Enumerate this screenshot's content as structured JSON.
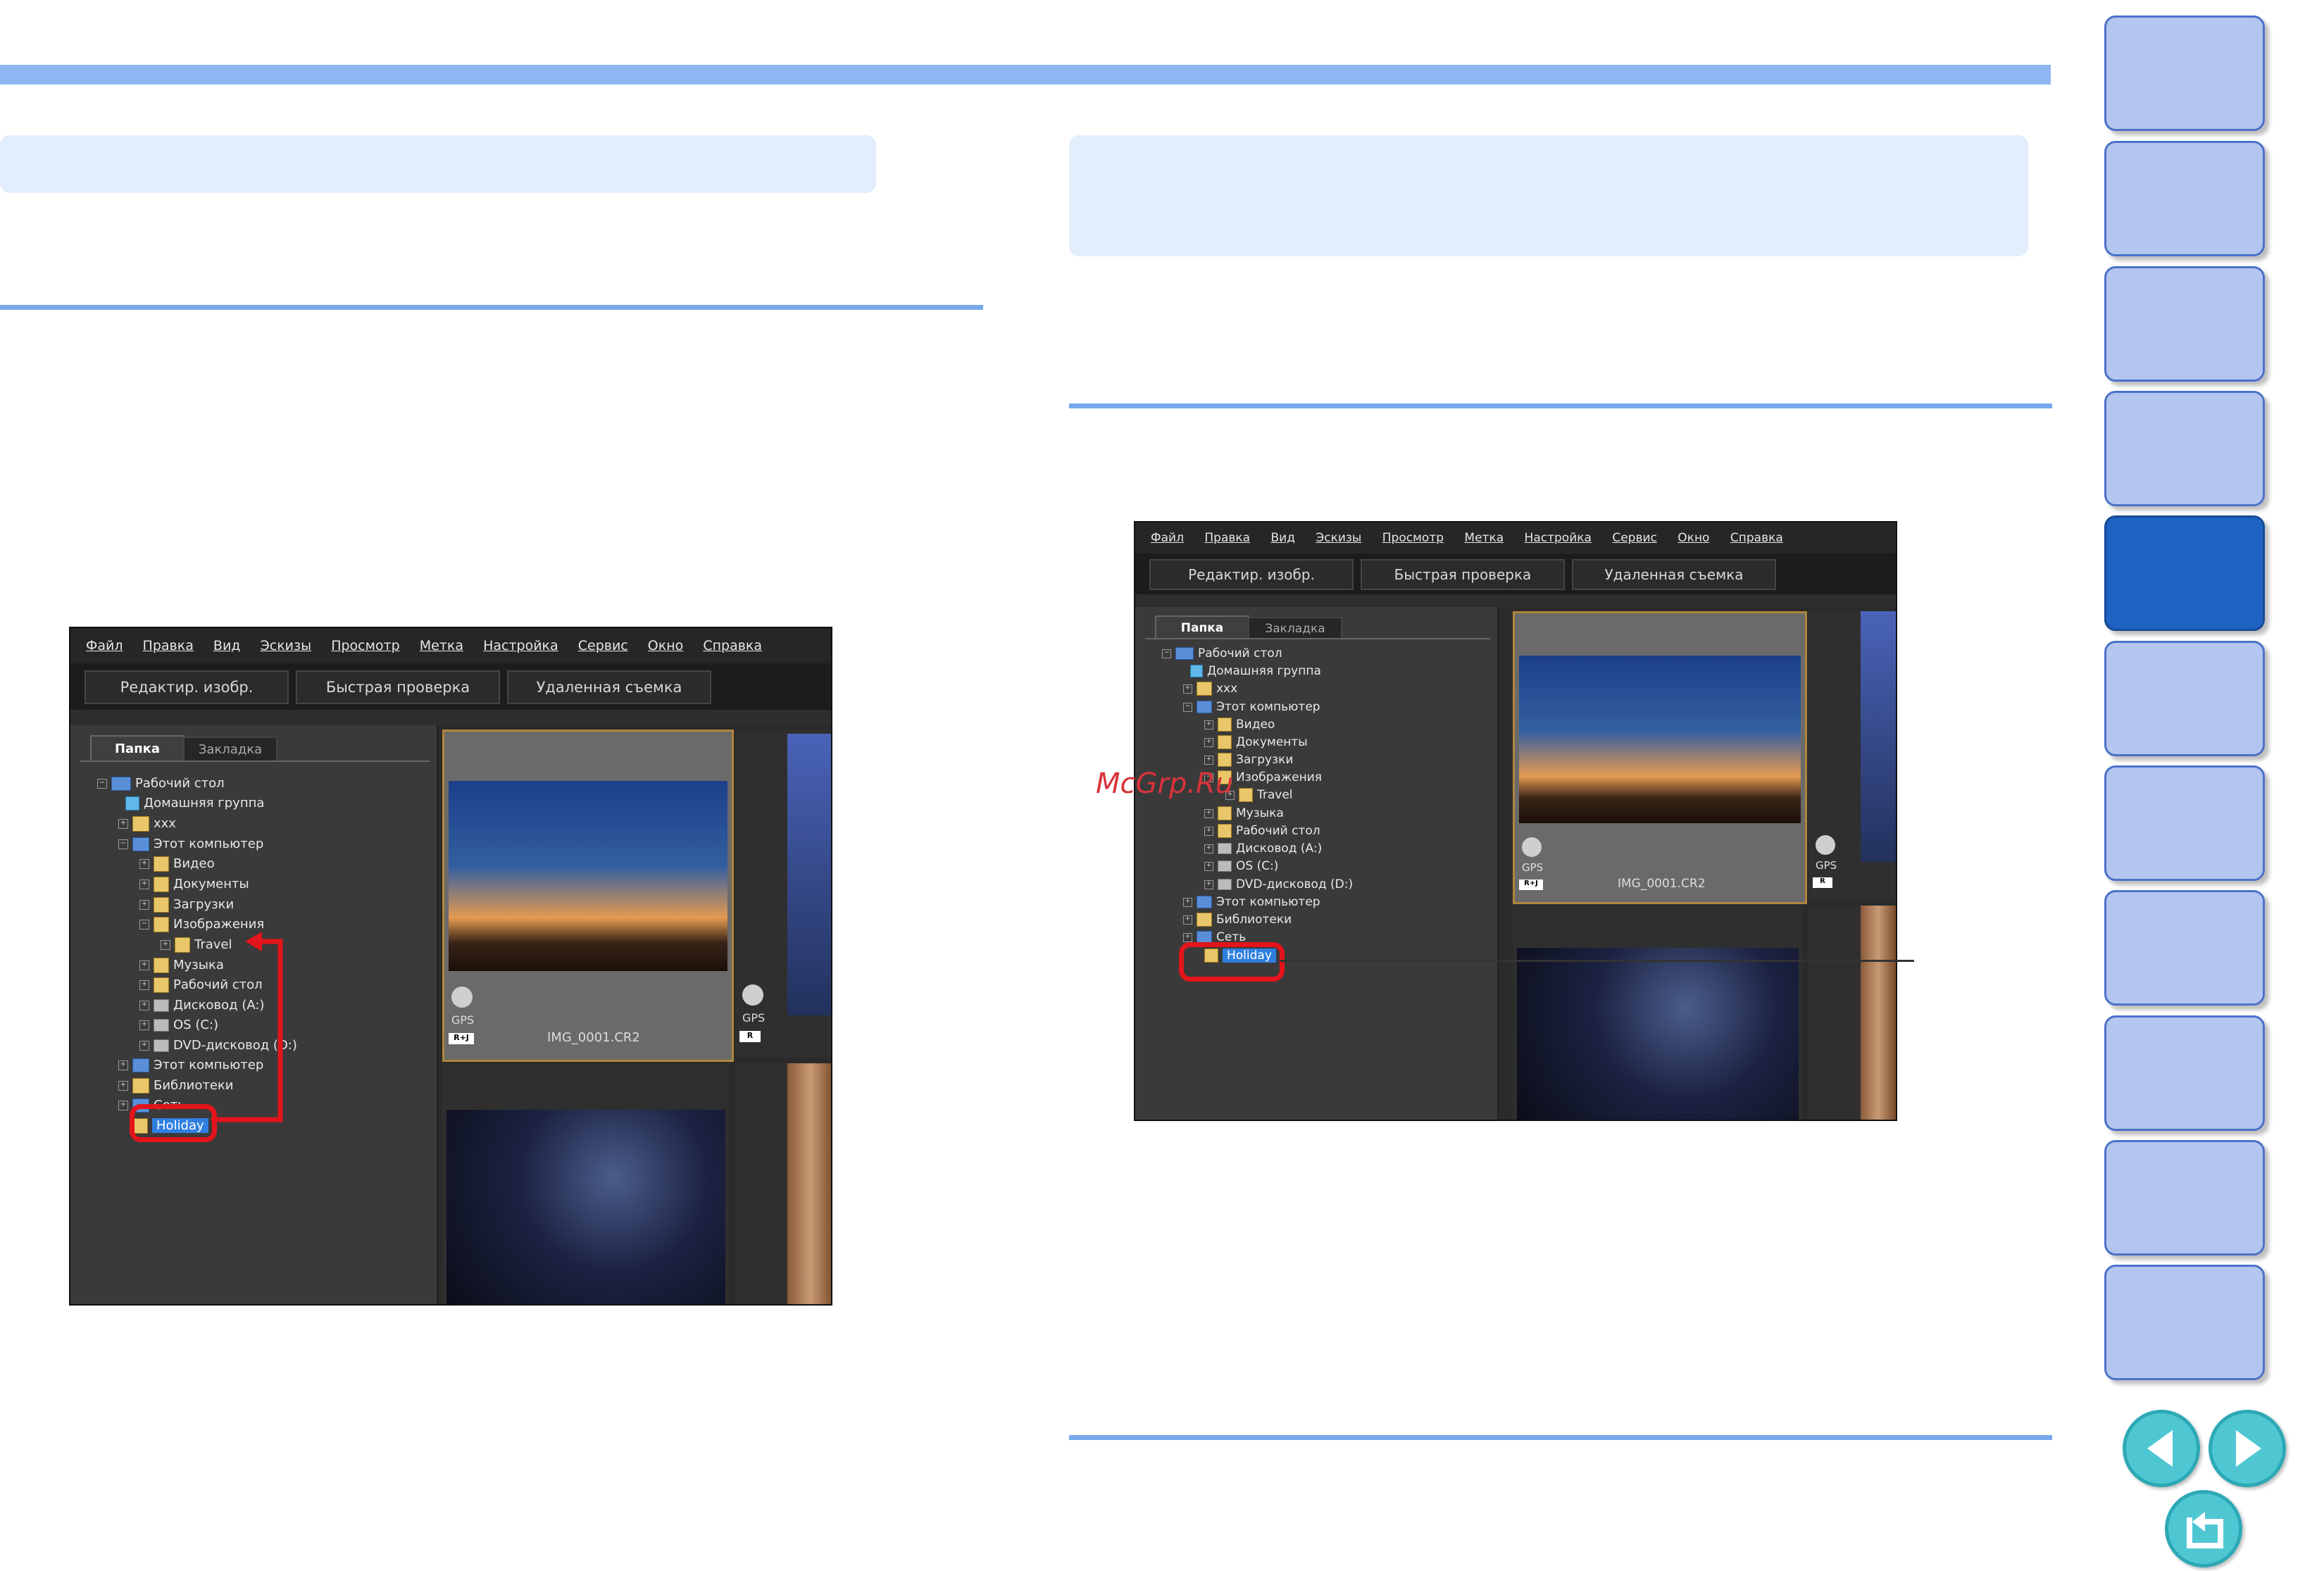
{
  "watermark": "McGrp.Ru",
  "menu": [
    "Файл",
    "Правка",
    "Вид",
    "Эскизы",
    "Просмотр",
    "Метка",
    "Настройка",
    "Сервис",
    "Окно",
    "Справка"
  ],
  "toolbar": [
    "Редактир. изобр.",
    "Быстрая проверка",
    "Удаленная съемка"
  ],
  "tabs": [
    "Папка",
    "Закладка"
  ],
  "tree_left": [
    "Рабочий стол",
    "Домашняя группа",
    "xxx",
    "Этот компьютер",
    "Видео",
    "Документы",
    "Загрузки",
    "Изображения",
    "Travel",
    "Музыка",
    "Рабочий стол",
    "Дисковод (A:)",
    "OS (C:)",
    "DVD-дисковод (D:)",
    "Этот компьютер",
    "Библиотеки",
    "Сеть",
    "Holiday"
  ],
  "tree_right": [
    "Рабочий стол",
    "Домашняя группа",
    "xxx",
    "Этот компьютер",
    "Видео",
    "Документы",
    "Загрузки",
    "Изображения",
    "Travel",
    "Музыка",
    "Рабочий стол",
    "Дисковод (A:)",
    "OS (C:)",
    "DVD-дисковод (D:)",
    "Этот компьютер",
    "Библиотеки",
    "Сеть",
    "Holiday"
  ],
  "thumb": {
    "gps": "GPS",
    "badge1": "R+J",
    "badge2": "R",
    "filename": "IMG_0001.CR2"
  },
  "colors": {
    "accent": "#78a8ec",
    "highlight": "#e3141b",
    "selection": "#2f7fe0"
  },
  "icons": {
    "back": "arrow-left-icon",
    "forward": "arrow-right-icon",
    "return": "return-icon"
  }
}
